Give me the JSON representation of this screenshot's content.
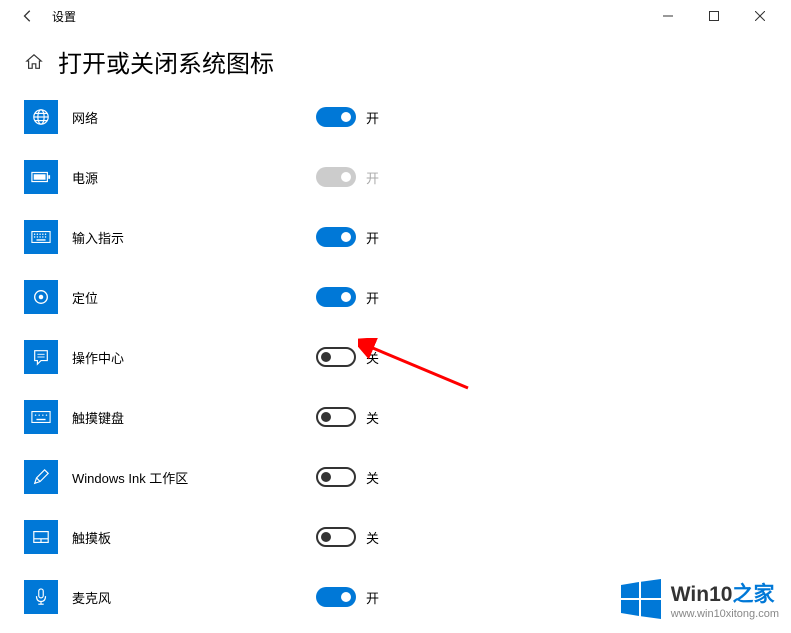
{
  "app_title": "设置",
  "page_title": "打开或关闭系统图标",
  "labels": {
    "on": "开",
    "off": "关"
  },
  "items": [
    {
      "id": "network",
      "label": "网络",
      "state": "on",
      "disabled": false
    },
    {
      "id": "power",
      "label": "电源",
      "state": "on",
      "disabled": true
    },
    {
      "id": "input",
      "label": "输入指示",
      "state": "on",
      "disabled": false
    },
    {
      "id": "location",
      "label": "定位",
      "state": "on",
      "disabled": false
    },
    {
      "id": "action-center",
      "label": "操作中心",
      "state": "off",
      "disabled": false
    },
    {
      "id": "touch-keyboard",
      "label": "触摸键盘",
      "state": "off",
      "disabled": false
    },
    {
      "id": "ink",
      "label": "Windows Ink 工作区",
      "state": "off",
      "disabled": false
    },
    {
      "id": "touchpad",
      "label": "触摸板",
      "state": "off",
      "disabled": false
    },
    {
      "id": "microphone",
      "label": "麦克风",
      "state": "on",
      "disabled": false
    }
  ],
  "watermark": {
    "title_en": "Win10",
    "title_zh": "之家",
    "url": "www.win10xitong.com"
  },
  "colors": {
    "accent": "#0078d7"
  }
}
